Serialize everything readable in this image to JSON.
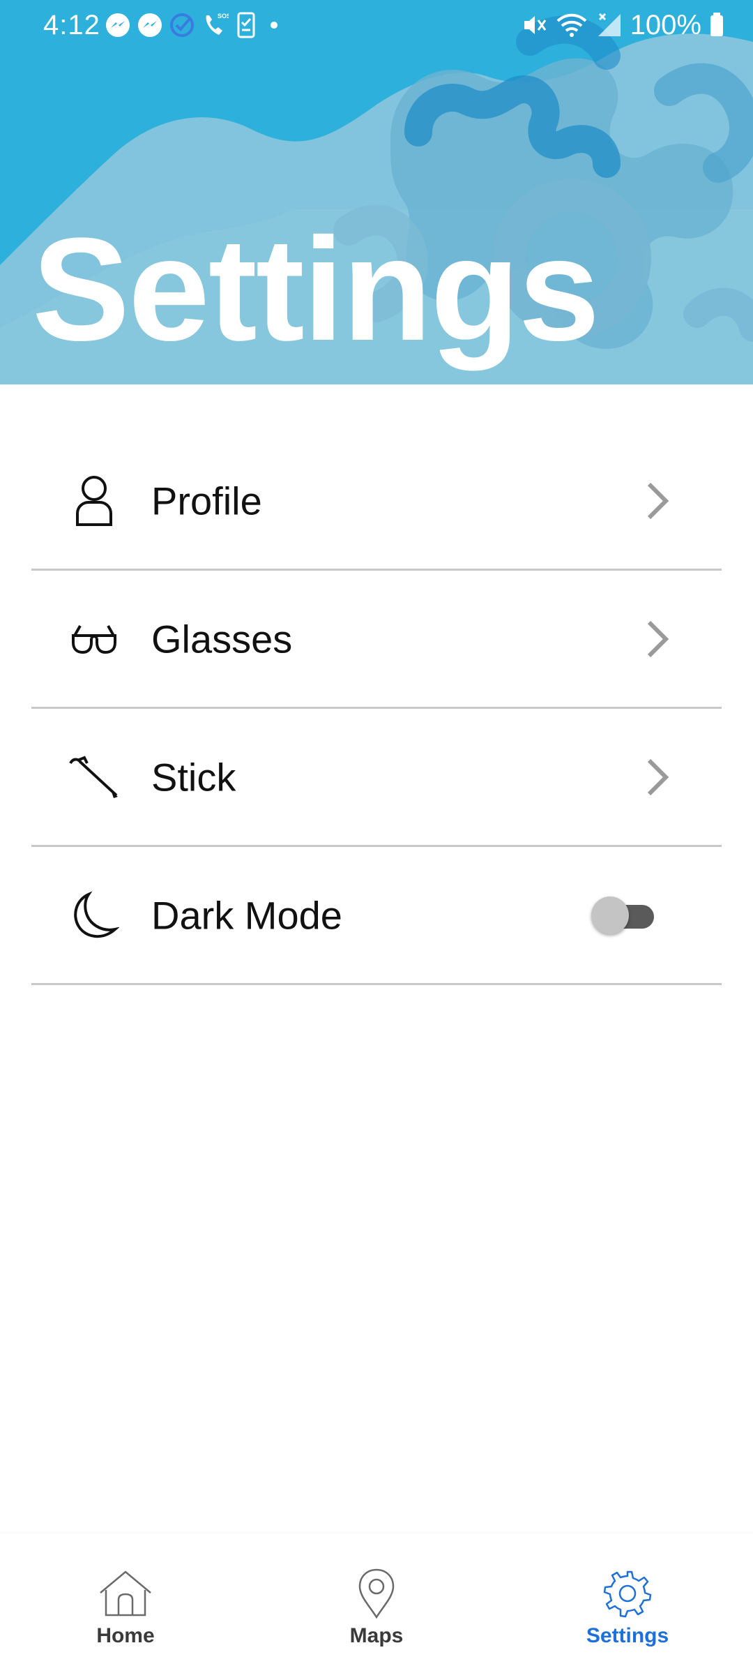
{
  "status_bar": {
    "time": "4:12",
    "battery": "100%",
    "left_icons": [
      "messenger-icon",
      "messenger-icon",
      "check-circle-icon",
      "sos-call-icon",
      "phone-clipboard-icon",
      "dot-icon"
    ],
    "right_icons": [
      "mute-vibrate-icon",
      "wifi-icon",
      "no-signal-icon",
      "battery-icon"
    ]
  },
  "header": {
    "title": "Settings",
    "color_primary": "#2db0dc",
    "color_pattern": "#8cc7dd"
  },
  "settings": {
    "items": [
      {
        "label": "Profile",
        "icon": "person-icon",
        "control": "chevron"
      },
      {
        "label": "Glasses",
        "icon": "glasses-icon",
        "control": "chevron"
      },
      {
        "label": "Stick",
        "icon": "stick-icon",
        "control": "chevron"
      },
      {
        "label": "Dark Mode",
        "icon": "moon-icon",
        "control": "toggle",
        "toggle_on": false
      }
    ]
  },
  "nav": {
    "items": [
      {
        "label": "Home",
        "icon": "home-icon",
        "active": false
      },
      {
        "label": "Maps",
        "icon": "map-pin-icon",
        "active": false
      },
      {
        "label": "Settings",
        "icon": "gear-icon",
        "active": true
      }
    ],
    "active_color": "#1e6fd9"
  }
}
